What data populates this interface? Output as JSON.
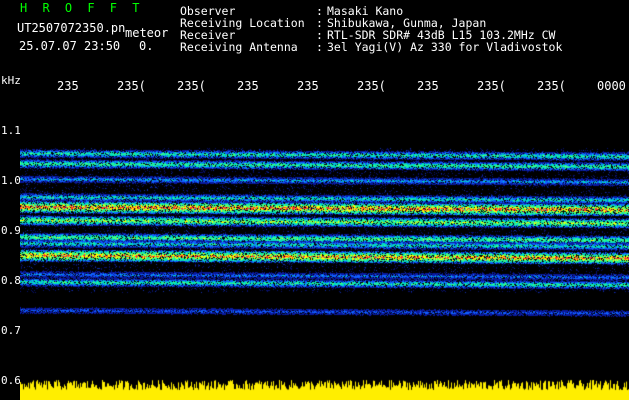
{
  "header": {
    "logo": "H R O F F T",
    "filename": "UT2507072350.pn",
    "mode": "meteor",
    "datetime": "25.07.07 23:50",
    "truncated": "0.",
    "info_labels": [
      "Observer",
      "Receiving Location",
      "Receiver",
      "Receiving Antenna"
    ],
    "info_colons": [
      ":",
      ":",
      ":",
      ":"
    ],
    "info_values": [
      "Masaki Kano",
      "Shibukawa, Gunma, Japan",
      "RTL-SDR SDR# 43dB L15 103.2MHz CW",
      "3el Yagi(V) Az 330 for Vladivostok"
    ]
  },
  "axis": {
    "unit": "kHz",
    "y_labels": [
      "1.1",
      "1.0",
      "0.9",
      "0.8",
      "0.7",
      "0.6"
    ],
    "time_labels": [
      "235",
      "235(",
      "235(",
      "235",
      "235",
      "235(",
      "235",
      "235(",
      "235(",
      "0000"
    ]
  },
  "spectrogram": {
    "freq_range_khz": [
      0.6,
      1.15
    ],
    "bands_khz": [
      0.936,
      0.842,
      1.02,
      0.91,
      0.877,
      0.79,
      0.955,
      0.735,
      1.04,
      0.865,
      0.99,
      0.805
    ],
    "colors": {
      "background": "#000000",
      "low": "#0a1aa0",
      "mid": "#00e0c0",
      "high": "#ffff00",
      "peak": "#ff3030",
      "noise_floor": "#ffee00"
    }
  }
}
